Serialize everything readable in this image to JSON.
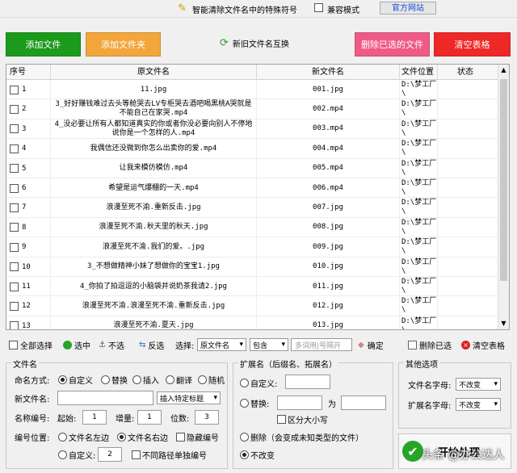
{
  "title_bar": {
    "app_title": "智能清除文件名中的特殊符号",
    "compat_mode": "兼容模式",
    "website": "官方网站"
  },
  "actions": {
    "add_file": "添加文件",
    "add_folder": "添加文件夹",
    "swap_names": "新旧文件名互换",
    "delete_selected": "删除已选的文件",
    "clear_table": "清空表格"
  },
  "table": {
    "headers": [
      "序号",
      "原文件名",
      "新文件名",
      "文件位置",
      "状态"
    ],
    "rows": [
      {
        "no": "1",
        "orig": "11.jpg",
        "new": "001.jpg",
        "loc": "D:\\梦工厂\\"
      },
      {
        "no": "2",
        "orig": "3_好好赚钱难过去头等舱哭去LV专柜哭去酒吧喝黑桃A哭就是不能自己在家哭.mp4",
        "new": "002.mp4",
        "loc": "D:\\梦工厂\\"
      },
      {
        "no": "3",
        "orig": "4_没必要让所有人都知道真实的你或者你没必要向别人不停地说你是一个怎样的人.mp4",
        "new": "003.mp4",
        "loc": "D:\\梦工厂\\"
      },
      {
        "no": "4",
        "orig": "我偶信还没微到你怎么出卖你的爱.mp4",
        "new": "004.mp4",
        "loc": "D:\\梦工厂\\"
      },
      {
        "no": "5",
        "orig": "让我来模仿模仿.mp4",
        "new": "005.mp4",
        "loc": "D:\\梦工厂\\"
      },
      {
        "no": "6",
        "orig": "希望是运气爆棚的一天.mp4",
        "new": "006.mp4",
        "loc": "D:\\梦工厂\\"
      },
      {
        "no": "7",
        "orig": "浪漫至死不渝.重新反击.jpg",
        "new": "007.jpg",
        "loc": "D:\\梦工厂\\"
      },
      {
        "no": "8",
        "orig": "浪漫至死不渝.秋天里的秋天.jpg",
        "new": "008.jpg",
        "loc": "D:\\梦工厂\\"
      },
      {
        "no": "9",
        "orig": "浪漫至死不渝.我们的爱。.jpg",
        "new": "009.jpg",
        "loc": "D:\\梦工厂\\"
      },
      {
        "no": "10",
        "orig": "3_不想做精神小妹了想做你的宝宝1.jpg",
        "new": "010.jpg",
        "loc": "D:\\梦工厂\\"
      },
      {
        "no": "11",
        "orig": "4_你拍了拍逗逗的小脑袋并说奶茶我请2.jpg",
        "new": "011.jpg",
        "loc": "D:\\梦工厂\\"
      },
      {
        "no": "12",
        "orig": "浪漫至死不渝.浪漫至死不渝.重新反击.jpg",
        "new": "012.jpg",
        "loc": "D:\\梦工厂\\"
      },
      {
        "no": "13",
        "orig": "浪漫至死不渝.夏天.jpg",
        "new": "013.jpg",
        "loc": "D:\\梦工厂\\"
      }
    ]
  },
  "toolbar": {
    "select_all": "全部选择",
    "select": "选中",
    "unselect": "不选",
    "invert": "反选",
    "choose_label": "选择:",
    "field_value": "原文件名",
    "match_value": "包含",
    "filter_placeholder": "多词用|号隔开",
    "confirm": "确定",
    "delete_selected": "删除已选",
    "clear_table": "清空表格"
  },
  "filename_panel": {
    "title": "文件名",
    "mode_label": "命名方式:",
    "mode_options": [
      "自定义",
      "替换",
      "插入",
      "翻译",
      "随机"
    ],
    "new_name_label": "新文件名:",
    "new_name_value": "",
    "insert_special": "插入特定标题",
    "number_label": "名称编号:",
    "start_label": "起始:",
    "start_value": "1",
    "step_label": "增量:",
    "step_value": "1",
    "digits_label": "位数:",
    "digits_value": "3",
    "pos_label": "编号位置:",
    "pos_left": "文件名左边",
    "pos_right": "文件名右边",
    "hide_number": "隐藏编号",
    "custom_label": "自定义:",
    "custom_value": "2",
    "diff_path": "不同路径单独编号"
  },
  "ext_panel": {
    "title": "扩展名（后缀名、拓展名）",
    "custom_label": "自定义:",
    "replace_label": "替换:",
    "to_label": "为",
    "case_label": "区分大小写",
    "delete_label": "删除（会变成未知类型的文件）",
    "nochange_label": "不改变"
  },
  "other_panel": {
    "title": "其他选项",
    "filename_case_label": "文件名字母:",
    "filename_case_value": "不改变",
    "ext_case_label": "扩展名字母:",
    "ext_case_value": "不改变"
  },
  "start_button": {
    "label": "开始处理"
  },
  "watermark": "头条 @办公达人",
  "colors": {
    "green": "#1c9a1c",
    "orange": "#f3a63b",
    "pink": "#ef5a87",
    "red": "#ee2727"
  }
}
